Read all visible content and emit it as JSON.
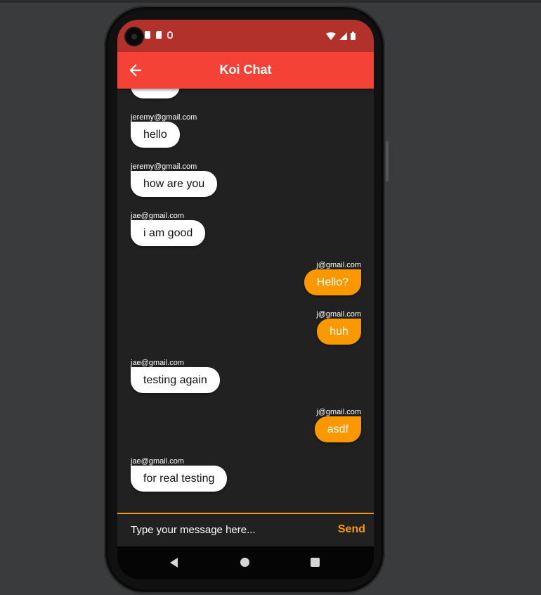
{
  "app_bar": {
    "title": "Koi Chat",
    "back_icon": "arrow-left-icon"
  },
  "status_bar": {
    "left_icons": [
      "notification-icon",
      "sd-card-icon",
      "debug-icon"
    ],
    "right_icons": [
      "wifi-icon",
      "signal-icon",
      "battery-icon"
    ]
  },
  "messages": [
    {
      "sender": "",
      "text": "work",
      "side": "received"
    },
    {
      "sender": "jeremy@gmail.com",
      "text": "hello",
      "side": "received"
    },
    {
      "sender": "jeremy@gmail.com",
      "text": "how are you",
      "side": "received"
    },
    {
      "sender": "jae@gmail.com",
      "text": "i am good",
      "side": "received"
    },
    {
      "sender": "j@gmail.com",
      "text": "Hello?",
      "side": "sent"
    },
    {
      "sender": "j@gmail.com",
      "text": "huh",
      "side": "sent"
    },
    {
      "sender": "jae@gmail.com",
      "text": "testing again",
      "side": "received"
    },
    {
      "sender": "j@gmail.com",
      "text": "asdf",
      "side": "sent"
    },
    {
      "sender": "jae@gmail.com",
      "text": "for real testing",
      "side": "received"
    }
  ],
  "composer": {
    "placeholder": "Type your message here...",
    "value": "",
    "send_label": "Send"
  },
  "colors": {
    "app_bar": "#f44336",
    "status_bar": "#b2322b",
    "accent": "#fb9800",
    "background": "#212121"
  },
  "nav_bar": {
    "icons": [
      "nav-back-icon",
      "nav-home-icon",
      "nav-recents-icon"
    ]
  }
}
